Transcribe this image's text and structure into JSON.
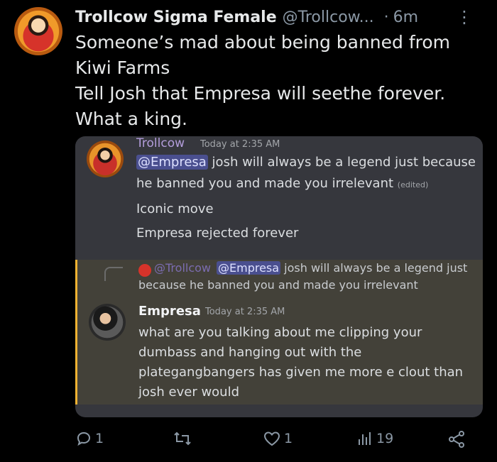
{
  "tweet": {
    "display_name": "Trollcow Sigma Female",
    "handle": "@Trollcow...",
    "dot": "·",
    "time": "6m",
    "more": "⋮",
    "lines": [
      "Someone’s mad about being banned from",
      "Kiwi Farms",
      "Tell Josh that Empresa will seethe forever.",
      "What a king."
    ]
  },
  "discord": {
    "msg1": {
      "author": "Trollcow",
      "timestamp": "Today at 2:35 AM",
      "mention": "@Empresa",
      "line1_rest": " josh will always be a legend just because",
      "line2": "he banned you and made you irrelevant",
      "edited": "(edited)",
      "line3": "Iconic move",
      "line4": "Empresa rejected forever"
    },
    "reply_preview": {
      "author": "@Trollcow",
      "mention": "@Empresa",
      "text1": " josh will always be a legend just",
      "text2": "because he banned you and made you irrelevant"
    },
    "msg2": {
      "author": "Empresa",
      "timestamp": "Today at 2:35 AM",
      "lines": [
        "what are you talking about me clipping your",
        "dumbass and hanging out with the",
        "plategangbangers has given me more e clout than",
        "josh ever would"
      ]
    }
  },
  "actions": {
    "replies": "1",
    "retweets": "",
    "likes": "1",
    "views": "19"
  },
  "colors": {
    "background": "#000000",
    "card": "#36373d",
    "highlight": "#434139",
    "accent_bar": "#f0b232",
    "muted": "#8b98a5"
  }
}
